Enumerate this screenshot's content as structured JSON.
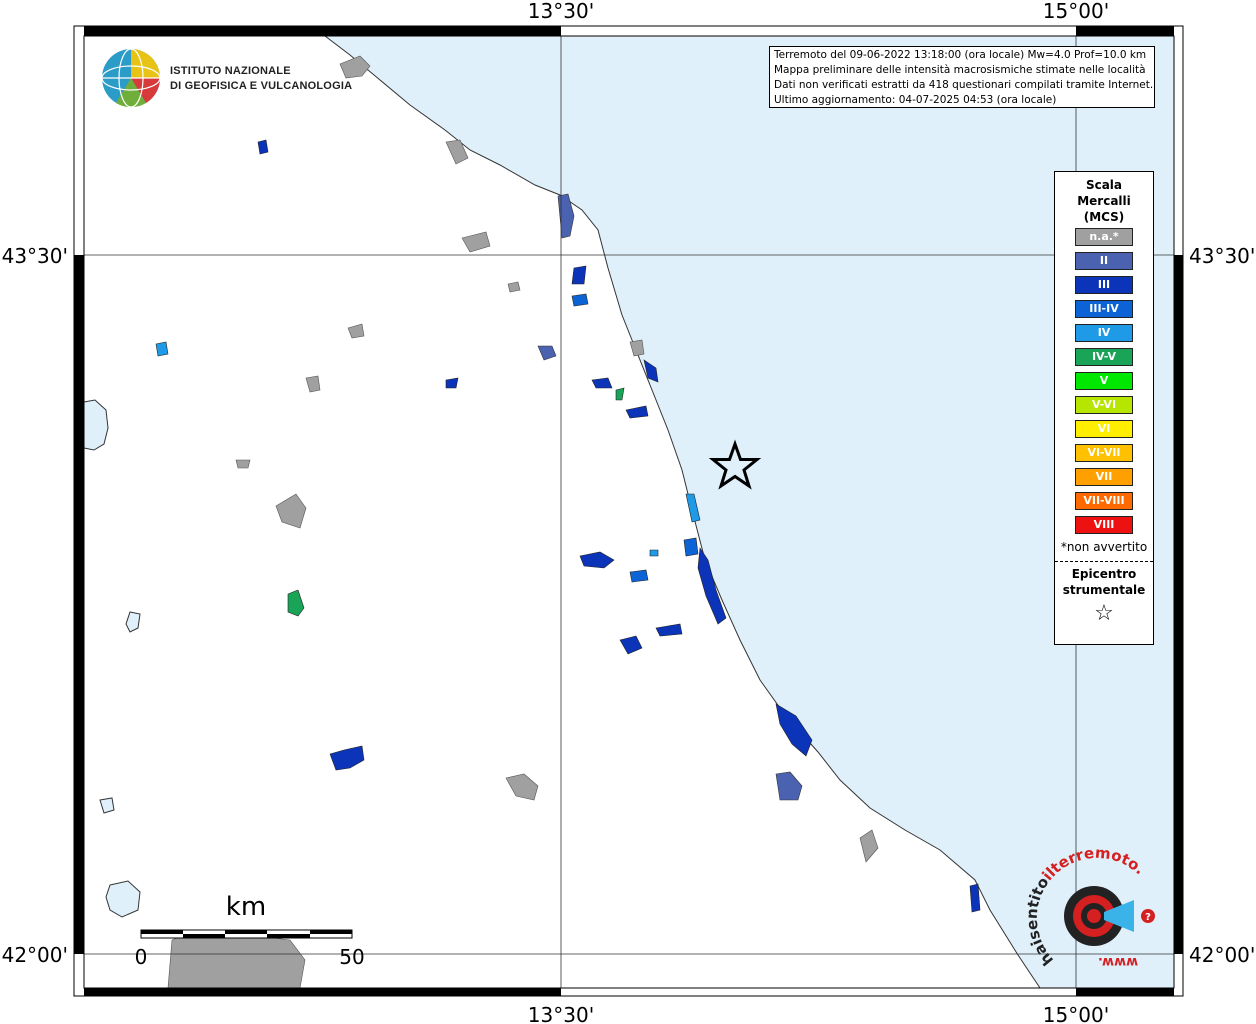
{
  "frame": {
    "top_lon_labels": [
      "13°30'",
      "15°00'"
    ],
    "bottom_lon_labels": [
      "13°30'",
      "15°00'"
    ],
    "left_lat_labels": [
      "43°30'",
      "42°00'"
    ],
    "right_lat_labels": [
      "43°30'",
      "42°00'"
    ]
  },
  "info": {
    "line1": "Terremoto del 09-06-2022 13:18:00 (ora locale) Mw=4.0 Prof=10.0 km",
    "line2": "Mappa preliminare delle intensità macrosismiche stimate nelle località",
    "line3": "Dati non verificati estratti da 418 questionari compilati tramite Internet.",
    "line4": "Ultimo aggiornamento: 04-07-2025 04:53 (ora locale)"
  },
  "logo": {
    "line1": "ISTITUTO NAZIONALE",
    "line2": "DI GEOFISICA E VULCANOLOGIA"
  },
  "legend": {
    "title1": "Scala",
    "title2": "Mercalli",
    "title3": "(MCS)",
    "items": [
      {
        "label": "n.a.*",
        "color": "#a0a0a0"
      },
      {
        "label": "II",
        "color": "#4a62b0"
      },
      {
        "label": "III",
        "color": "#0c34b8"
      },
      {
        "label": "III-IV",
        "color": "#0b63d6"
      },
      {
        "label": "IV",
        "color": "#1e9ae6"
      },
      {
        "label": "IV-V",
        "color": "#1aa457"
      },
      {
        "label": "V",
        "color": "#00e800"
      },
      {
        "label": "V-VI",
        "color": "#b6e600"
      },
      {
        "label": "VI",
        "color": "#ffee00"
      },
      {
        "label": "VI-VII",
        "color": "#ffc000"
      },
      {
        "label": "VII",
        "color": "#ffa000"
      },
      {
        "label": "VII-VIII",
        "color": "#ff6a00"
      },
      {
        "label": "VIII",
        "color": "#ee1111"
      }
    ],
    "note": "*non avvertito",
    "epicentre1": "Epicentro",
    "epicentre2": "strumentale",
    "star": "☆"
  },
  "scale": {
    "unit": "km",
    "label_start": "0",
    "label_end": "50"
  },
  "watermark": {
    "text1": "haisentito",
    "text2": "ilterremoto.it",
    "text3": "www."
  },
  "colors": {
    "sea": "#dff0fb",
    "coast": "#333333"
  }
}
